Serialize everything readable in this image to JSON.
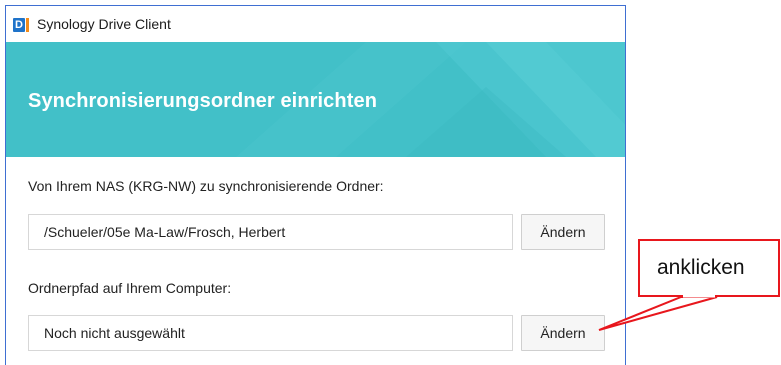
{
  "window": {
    "title": "Synology Drive Client",
    "app_logo_letter": "D"
  },
  "banner": {
    "title": "Synchronisierungsordner einrichten"
  },
  "nas_folder": {
    "label": "Von Ihrem NAS (KRG-NW) zu synchronisierende Ordner:",
    "value": "/Schueler/05e Ma-Law/Frosch, Herbert",
    "button_label": "Ändern"
  },
  "local_folder": {
    "label": "Ordnerpfad auf Ihrem Computer:",
    "value": "Noch nicht ausgewählt",
    "button_label": "Ändern"
  },
  "annotation": {
    "text": "anklicken"
  },
  "colors": {
    "banner": "#42c0c8",
    "callout_red": "#e8171d",
    "window_border": "#3f6fd2",
    "logo_blue": "#1f73c9",
    "logo_orange": "#f38c1b"
  }
}
